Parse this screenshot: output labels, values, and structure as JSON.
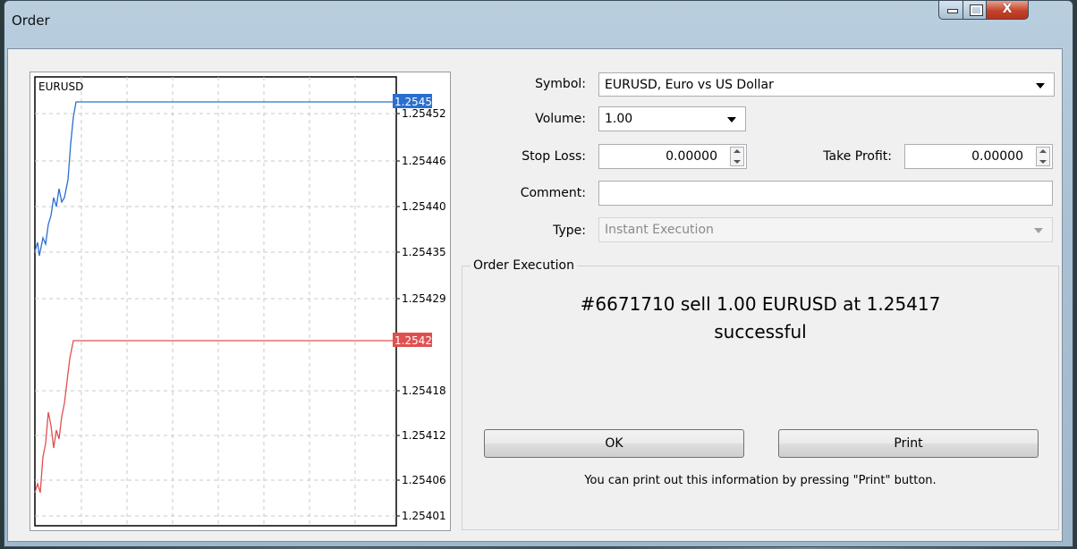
{
  "window": {
    "title": "Order",
    "close_glyph": "X"
  },
  "chart": {
    "symbol": "EURUSD",
    "price_labels": [
      "1.25452",
      "1.25446",
      "1.25440",
      "1.25435",
      "1.25429",
      "1.25418",
      "1.25412",
      "1.25406",
      "1.25401"
    ],
    "ask_marker": "1.25454",
    "bid_marker": "1.25424",
    "ask_color": "#2a6fcf",
    "bid_color": "#e05050"
  },
  "form": {
    "symbol_label": "Symbol:",
    "symbol_value": "EURUSD, Euro vs US Dollar",
    "volume_label": "Volume:",
    "volume_value": "1.00",
    "stop_loss_label": "Stop Loss:",
    "stop_loss_value": "0.00000",
    "take_profit_label": "Take Profit:",
    "take_profit_value": "0.00000",
    "comment_label": "Comment:",
    "comment_value": "",
    "type_label": "Type:",
    "type_value": "Instant Execution"
  },
  "execution": {
    "group_title": "Order Execution",
    "result_line1": "#6671710 sell 1.00 EURUSD at 1.25417",
    "result_line2": "successful",
    "ok_label": "OK",
    "print_label": "Print",
    "hint": "You can print out this information by pressing \"Print\" button."
  }
}
